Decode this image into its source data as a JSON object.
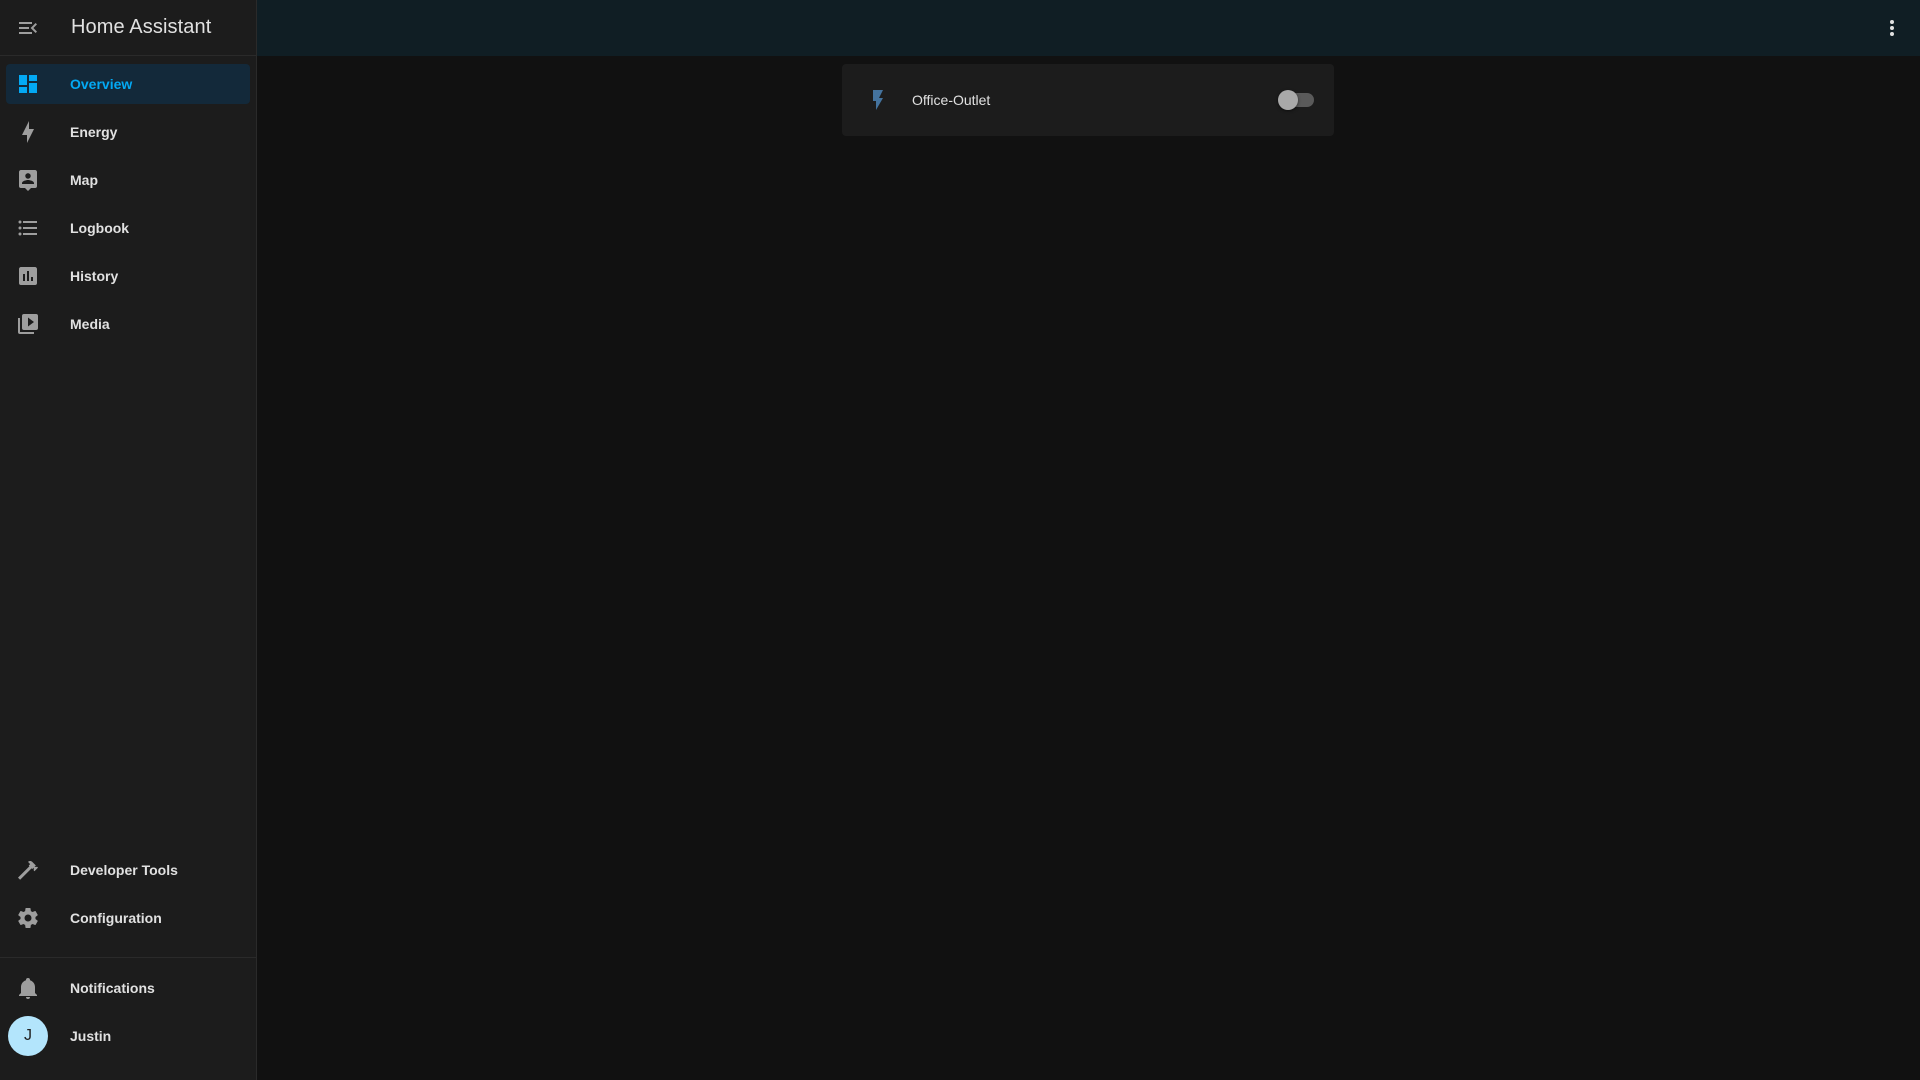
{
  "app": {
    "title": "Home Assistant"
  },
  "sidebar": {
    "items": [
      {
        "label": "Overview",
        "icon": "dashboard-icon",
        "selected": true
      },
      {
        "label": "Energy",
        "icon": "lightning-bolt-icon"
      },
      {
        "label": "Map",
        "icon": "map-person-icon"
      },
      {
        "label": "Logbook",
        "icon": "list-icon"
      },
      {
        "label": "History",
        "icon": "chart-box-icon"
      },
      {
        "label": "Media",
        "icon": "play-box-multiple-icon"
      }
    ],
    "tools": [
      {
        "label": "Developer Tools",
        "icon": "hammer-icon"
      },
      {
        "label": "Configuration",
        "icon": "gear-icon"
      }
    ],
    "notifications": {
      "label": "Notifications",
      "icon": "bell-icon"
    },
    "user": {
      "name": "Justin",
      "initial": "J"
    }
  },
  "card": {
    "entity_name": "Office-Outlet",
    "icon": "flash-icon",
    "state_on": false
  },
  "colors": {
    "accent": "#03a9f4",
    "sidebar_bg": "#1c1c1c",
    "topbar_bg": "#101e24",
    "page_bg": "#111111",
    "selected_bg": "#13293a",
    "avatar_bg": "#b3e5fc",
    "entity_icon": "#44739e"
  }
}
